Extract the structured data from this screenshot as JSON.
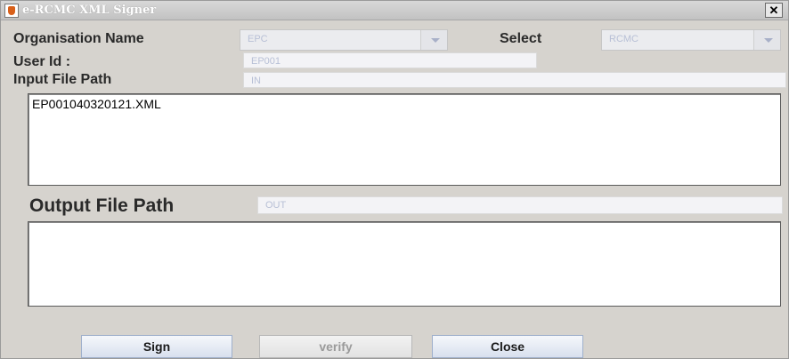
{
  "window": {
    "title": "e-RCMC XML Signer",
    "close_glyph": "✕"
  },
  "form": {
    "organisation_label": "Organisation Name",
    "organisation_value": "EPC",
    "select_label": "Select",
    "select_value": "RCMC",
    "userid_label": "User Id :",
    "userid_value": "EP001",
    "input_path_label": "Input File Path",
    "input_path_value": "IN",
    "input_files": "EP001040320121.XML",
    "output_path_label": "Output File Path",
    "output_path_value": "OUT",
    "output_files": ""
  },
  "buttons": {
    "sign": "Sign",
    "verify": "verify",
    "close": "Close"
  },
  "icons": {
    "app": "java-cup-icon",
    "combo_arrow": "chevron-down-icon"
  },
  "colors": {
    "background": "#d6d3ce",
    "field_text": "#b8c0d6"
  }
}
